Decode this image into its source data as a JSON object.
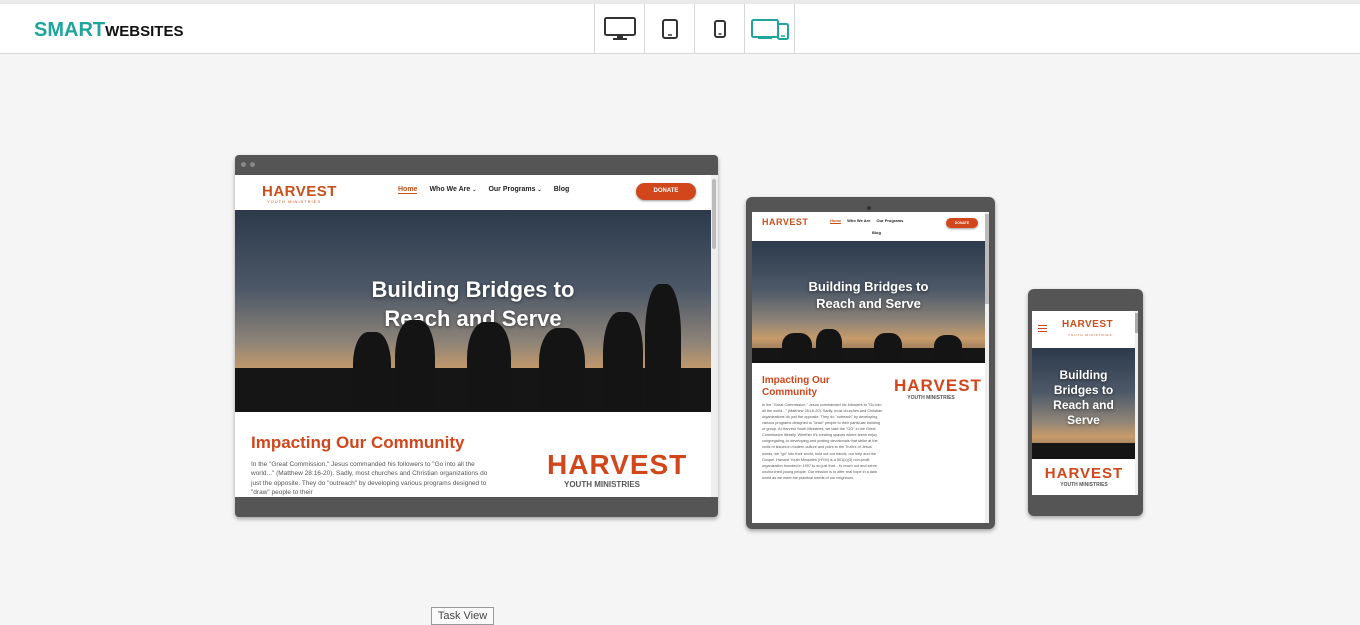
{
  "app": {
    "logo_primary": "SMART",
    "logo_secondary": "WEBSITES"
  },
  "device_toolbar": {
    "buttons": [
      {
        "icon": "desktop-icon"
      },
      {
        "icon": "tablet-icon"
      },
      {
        "icon": "phone-icon"
      },
      {
        "icon": "all-devices-icon",
        "active": true
      }
    ],
    "active_color": "#1fa59b"
  },
  "site": {
    "brand": "HARVEST",
    "brand_sub": "YOUTH MINISTRIES",
    "nav": {
      "home": "Home",
      "who": "Who We Are",
      "programs": "Our Programs",
      "blog": "Blog",
      "donate": "DONATE"
    },
    "hero_line1": "Building Bridges to",
    "hero_line2": "Reach and Serve",
    "hero_phone_1": "Building",
    "hero_phone_2": "Bridges to",
    "hero_phone_3": "Reach and",
    "hero_phone_4": "Serve",
    "section_title": "Impacting Our Community",
    "section_title_l1": "Impacting Our",
    "section_title_l2": "Community",
    "desktop_body": "In the \"Great Commission,\" Jesus commanded his followers to \"Go into all the world...\" (Matthew 28:16-20). Sadly, most churches and Christian organizations do just the opposite. They do \"outreach\" by developing various programs designed to \"draw\" people to their",
    "tablet_body": "In the \"Great Commission,\" Jesus commanded his followers to \"Go into all the world...\" (Matthew 28:16-20). Sadly, most churches and Christian organizations do just the opposite. They do \"outreach\" by developing various programs designed to \"draw\" people to their particular building or group. At Harvest Youth Ministries, we take the \"GO\" in the Great Commission literally. Whether it's creating spaces where teens enjoy congregating, to developing and posting devotionals that strike at the roots of issues in modern culture and point to the Truth's of Jesus' words, we \"go\" into their world, hold out our hands, our help and the Gospel. Harvest Youth Ministries (HYM) is a 501(c)(3) non-profit organization founded in 1997 to do just that... to reach out and serve unchurched young people. Our mission is to offer real hope in a dark world as we meet the practical needs of our neighbors.",
    "stamp_big": "HARVEST",
    "stamp_small": "YOUTH MINISTRIES",
    "brand_color": "#d2461b"
  },
  "taskbar_tooltip": "Task View"
}
